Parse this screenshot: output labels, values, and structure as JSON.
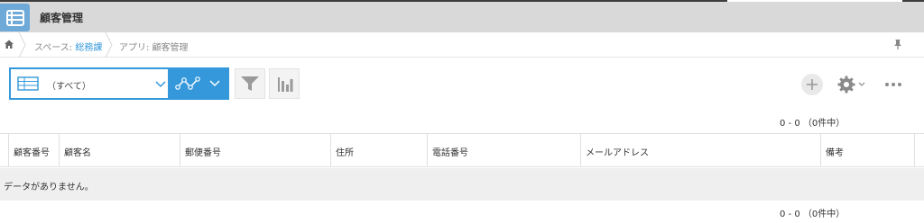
{
  "app": {
    "title": "顧客管理"
  },
  "breadcrumb": {
    "space_prefix": "スペース: ",
    "space_name": "総務課",
    "app_crumb": "アプリ: 顧客管理"
  },
  "toolbar": {
    "view_selector_value": "（すべて）"
  },
  "pagination": {
    "top": "0 - 0 （0件中）",
    "bottom": "0 - 0 （0件中）"
  },
  "table": {
    "columns": [
      "顧客番号",
      "顧客名",
      "郵便番号",
      "住所",
      "電話番号",
      "メールアドレス",
      "備考"
    ],
    "empty_message": "データがありません。"
  },
  "colors": {
    "accent": "#3498db",
    "appbar": "#d9d9d9",
    "app_icon": "#6ea9d8",
    "empty_row": "#efefef"
  }
}
